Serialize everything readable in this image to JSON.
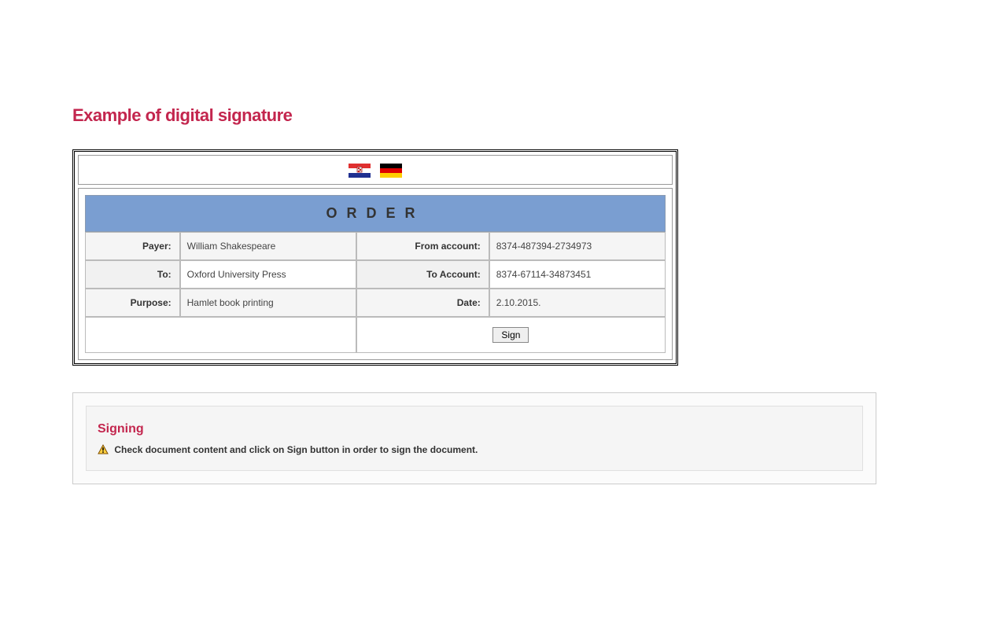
{
  "page_title": "Example of digital signature",
  "flags": {
    "left": "croatia-flag-icon",
    "right": "germany-flag-icon"
  },
  "order": {
    "title": "ORDER",
    "labels": {
      "payer": "Payer:",
      "to": "To:",
      "purpose": "Purpose:",
      "from_account": "From account:",
      "to_account": "To Account:",
      "date": "Date:"
    },
    "values": {
      "payer": "William Shakespeare",
      "to": "Oxford University Press",
      "purpose": "Hamlet book printing",
      "from_account": "8374-487394-2734973",
      "to_account": "8374-67114-34873451",
      "date": "2.10.2015."
    },
    "sign_button": "Sign"
  },
  "signing": {
    "heading": "Signing",
    "message": "Check document content and click on Sign button in order to sign the document."
  }
}
